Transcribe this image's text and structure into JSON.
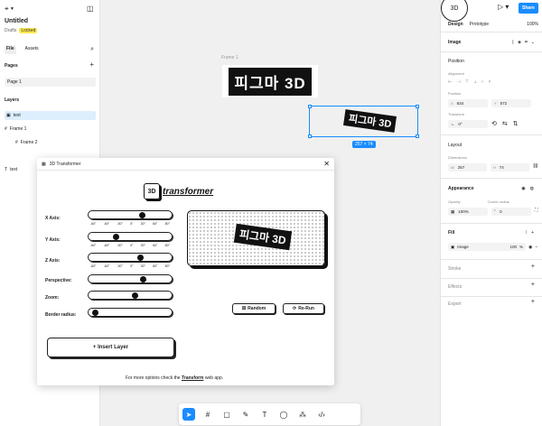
{
  "file": {
    "title": "Untitled",
    "drafts": "Drafts",
    "locked": "Locked"
  },
  "left_tabs": {
    "file": "File",
    "assets": "Assets"
  },
  "pages": {
    "title": "Pages",
    "items": [
      "Page 1"
    ]
  },
  "layers": {
    "title": "Layers",
    "items": [
      "text",
      "Frame 1",
      "Frame 2",
      "text"
    ]
  },
  "canvas": {
    "frame_label": "Frame 1",
    "frame_text": "피그마 3D",
    "selection_text": "피그마 3D",
    "dimensions": "257 × 74"
  },
  "plugin": {
    "title": "3D Transformer",
    "logo_cube": "3D",
    "logo_word": "transformer",
    "x_axis": "X Axis:",
    "y_axis": "Y Axis:",
    "z_axis": "Z Axis:",
    "perspective": "Perspective:",
    "zoom": "Zoom:",
    "border_radius": "Border radius:",
    "ticks": [
      "-60°",
      "-60°",
      "-30°",
      "0°",
      "30°",
      "60°",
      "80°"
    ],
    "slider_values": {
      "x": 0.65,
      "y": 0.3,
      "z": 0.62,
      "perspective": 0.66,
      "zoom": 0.55,
      "border_radius": 0.03
    },
    "preview_text": "피그마 3D",
    "random": "Random",
    "rerun": "Re-Run",
    "insert": "+ Insert Layer",
    "footer_prefix": "For more options check the",
    "footer_link": "Transform",
    "footer_suffix": "web app."
  },
  "right": {
    "share": "Share",
    "avatar": "3D",
    "design_tab": "Design",
    "prototype_tab": "Prototype",
    "zoom": "100%",
    "image_title": "Image",
    "position_title": "Position",
    "alignment": "Alignment",
    "position_label": "Position",
    "x_label": "X",
    "x_value": "634",
    "y_label": "Y",
    "y_value": "572",
    "transform_label": "Transform",
    "rotation": "0°",
    "layout_title": "Layout",
    "dimensions_label": "Dimensions",
    "w_label": "W",
    "w_value": "257",
    "h_label": "H",
    "h_value": "74",
    "appearance_title": "Appearance",
    "opacity_label": "Opacity",
    "opacity_value": "100%",
    "corner_label": "Corner radius",
    "corner_value": "0",
    "fill_title": "Fill",
    "fill_type": "Image",
    "fill_opacity": "100",
    "fill_pct": "%",
    "stroke_title": "Stroke",
    "effects_title": "Effects",
    "export_title": "Export"
  },
  "colors": {
    "accent": "#1a8cff",
    "locked": "#ffe94d"
  }
}
